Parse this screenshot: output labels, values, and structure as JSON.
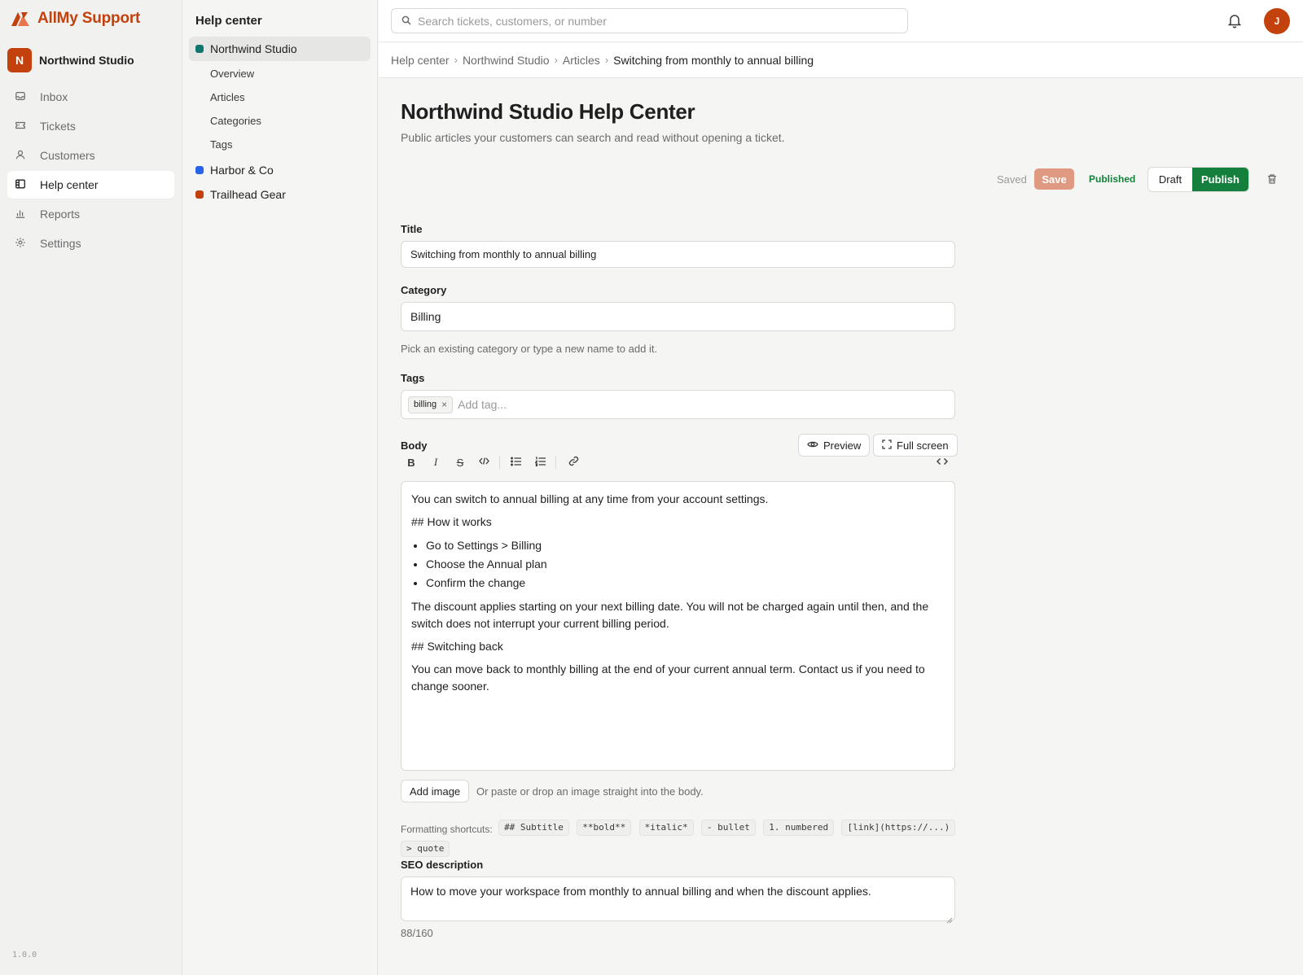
{
  "app": {
    "name": "AllMy Support",
    "version": "1.0.0",
    "accent": "#c2410c"
  },
  "workspace": {
    "initial": "N",
    "name": "Northwind Studio"
  },
  "nav": {
    "items": [
      {
        "label": "Inbox",
        "icon": "inbox-icon"
      },
      {
        "label": "Tickets",
        "icon": "ticket-icon"
      },
      {
        "label": "Customers",
        "icon": "user-icon"
      },
      {
        "label": "Help center",
        "icon": "book-icon",
        "active": true
      },
      {
        "label": "Reports",
        "icon": "bar-chart-icon"
      },
      {
        "label": "Settings",
        "icon": "gear-icon"
      }
    ]
  },
  "subnav": {
    "title": "Help center",
    "sites": [
      {
        "label": "Northwind Studio",
        "color": "#0f766e",
        "active": true
      },
      {
        "label": "Harbor & Co",
        "color": "#2563eb"
      },
      {
        "label": "Trailhead Gear",
        "color": "#c2410c"
      }
    ],
    "links": [
      "Overview",
      "Articles",
      "Categories",
      "Tags"
    ]
  },
  "topbar": {
    "search_placeholder": "Search tickets, customers, or number",
    "user_initial": "J"
  },
  "breadcrumb": [
    "Help center",
    "Northwind Studio",
    "Articles",
    "Switching from monthly to annual billing"
  ],
  "page": {
    "title": "Northwind Studio Help Center",
    "subtitle": "Public articles your customers can search and read without opening a ticket."
  },
  "actions": {
    "saved_text": "Saved",
    "save_label": "Save",
    "status": "Published",
    "draft_label": "Draft",
    "publish_label": "Publish",
    "status_color": "#15803d"
  },
  "form": {
    "title_label": "Title",
    "title_value": "Switching from monthly to annual billing",
    "category_label": "Category",
    "category_value": "Billing",
    "category_hint": "Pick an existing category or type a new name to add it.",
    "tags_label": "Tags",
    "tags": [
      "billing"
    ],
    "tag_placeholder": "Add tag...",
    "body_label": "Body",
    "preview_label": "Preview",
    "fullscreen_label": "Full screen",
    "toolbar": {
      "bold": "B",
      "italic": "I",
      "strike": "S"
    },
    "body": {
      "p1": "You can switch to annual billing at any time from your account settings.",
      "h1": "## How it works",
      "steps": [
        "Go to Settings > Billing",
        "Choose the Annual plan",
        "Confirm the change"
      ],
      "p2": "The discount applies starting on your next billing date. You will not be charged again until then, and the switch does not interrupt your current billing period.",
      "h2": "## Switching back",
      "p3": "You can move back to monthly billing at the end of your current annual term. Contact us if you need to change sooner."
    },
    "add_image_label": "Add image",
    "add_image_hint": "Or paste or drop an image straight into the body.",
    "shortcuts_label": "Formatting shortcuts:",
    "shortcuts": [
      "## Subtitle",
      "**bold**",
      "*italic*",
      "- bullet",
      "1. numbered",
      "[link](https://...)",
      "> quote"
    ],
    "seo_label": "SEO description",
    "seo_value": "How to move your workspace from monthly to annual billing and when the discount applies.",
    "seo_counter": "88/160"
  }
}
